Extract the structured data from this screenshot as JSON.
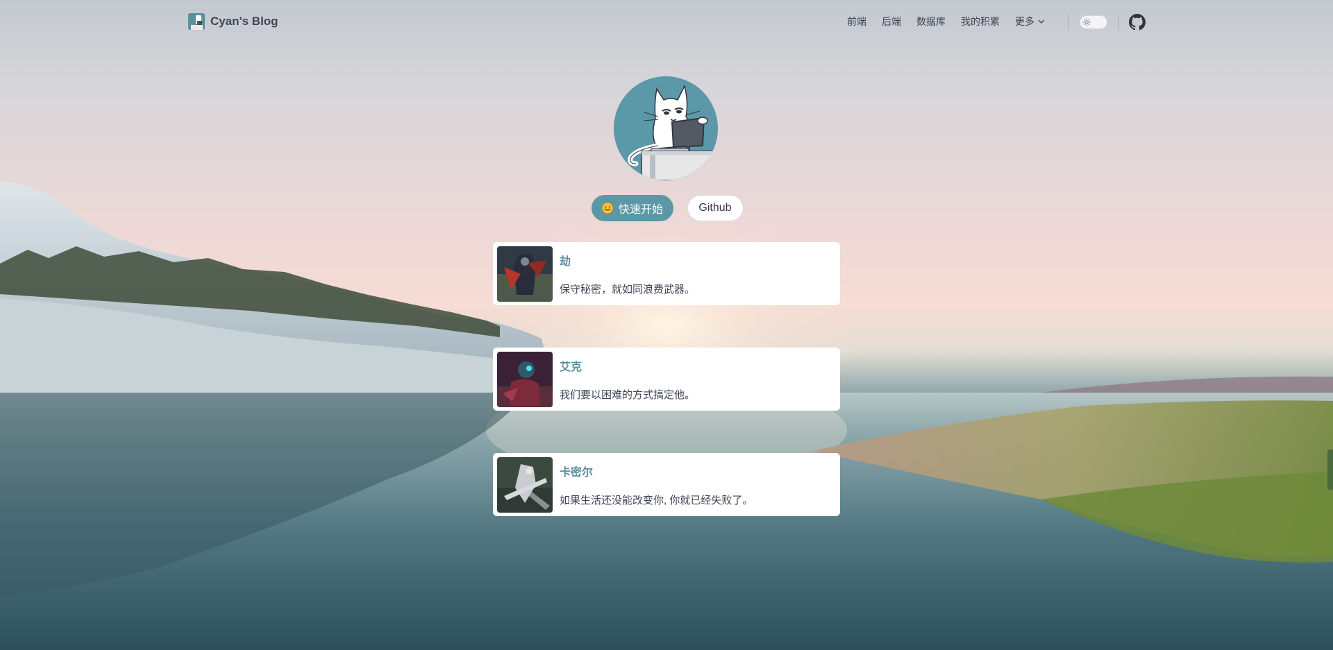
{
  "header": {
    "brand_title": "Cyan's Blog",
    "nav": [
      "前端",
      "后端",
      "数据库",
      "我的积累",
      "更多"
    ]
  },
  "hero": {
    "primary_button": "快速开始",
    "secondary_button": "Github"
  },
  "cards": [
    {
      "name": "劫",
      "quote": "保守秘密，就如同浪费武器。"
    },
    {
      "name": "艾克",
      "quote": "我们要以困难的方式搞定他。"
    },
    {
      "name": "卡密尔",
      "quote": "如果生活还没能改变你, 你就已经失败了。"
    }
  ],
  "colors": {
    "accent": "#5d8fa0",
    "primary_button": "#5c97a6",
    "card_bg": "#ffffff",
    "text": "#3c4452"
  },
  "icons": [
    "brand-logo",
    "chevron-down-icon",
    "sun-icon",
    "github-icon",
    "smile-icon"
  ]
}
